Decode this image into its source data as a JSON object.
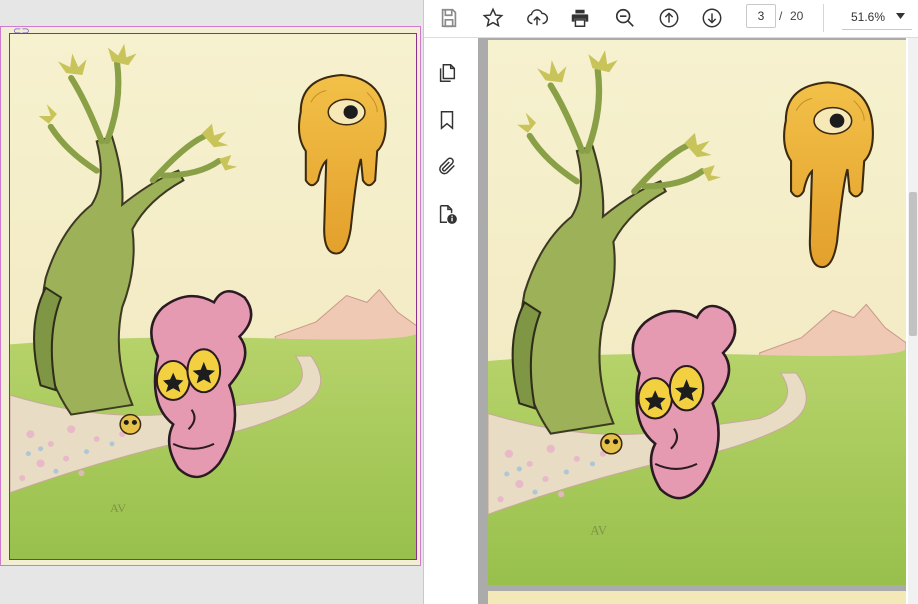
{
  "toolbar": {
    "icons": [
      "save-icon",
      "star-icon",
      "upload-cloud-icon",
      "print-icon",
      "zoom-out-icon",
      "arrow-up-circle-icon",
      "arrow-down-circle-icon"
    ],
    "current_page": "3",
    "page_separator": "/",
    "total_pages": "20",
    "zoom": "51.6%"
  },
  "side_tools": [
    "copy-pages-icon",
    "bookmark-icon",
    "paperclip-icon",
    "document-info-icon"
  ],
  "colors": {
    "sky": "#f5eec8",
    "grass": "#a9c95a",
    "tree": "#a3b35a",
    "creature": "#e59ab2",
    "drip": "#e9b23a",
    "frame_border": "#d07ad0"
  },
  "artwork_icons": [
    "tree-icon",
    "dripping-eye-blob-icon",
    "pink-creature-icon",
    "flower-path-icon"
  ],
  "artwork_text": "AV"
}
